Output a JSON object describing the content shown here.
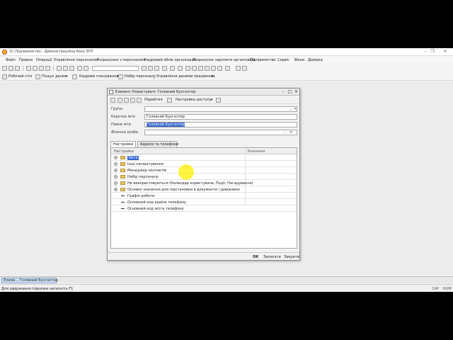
{
  "app": {
    "title": "1С:Підприємство - Демонстраційна база ЗУП"
  },
  "menu": [
    "Файл",
    "Правка",
    "Операції",
    "Управління персоналом",
    "Розрахунки з персоналом",
    "Кадровий облік організацій",
    "Розрахунок зарплати організацій",
    "Підприємство",
    "Сервіс",
    "Вікна",
    "Довідка"
  ],
  "toolbar2": {
    "desktop": "Робочий стіл",
    "search": "Пошук даних",
    "planning": "Кадрове планування",
    "hiring": "Набір персоналу",
    "employee_data": "Управління даними працівника"
  },
  "dialog": {
    "title": "Елемент Користувачі: Головний Бухгалтер",
    "goto": "Перейти",
    "access": "Настройка доступу",
    "fields": {
      "group_label": "Група:",
      "group_value": "",
      "short_name_label": "Коротке ім'я:",
      "short_name_value": "Головний Бухгалтер",
      "full_name_label": "Повне ім'я:",
      "full_name_value": "Головний Бухгалтер",
      "person_label": "Фізична особа:",
      "person_value": ""
    },
    "tabs": [
      "Настройки",
      "Адреси та телефони"
    ],
    "grid": {
      "col1": "Настройка",
      "col2": "Значення",
      "rows": [
        {
          "label": "Звіти",
          "kind": "folder",
          "selected": true
        },
        {
          "label": "Інші налаштування",
          "kind": "folder"
        },
        {
          "label": "Менеджер контактів",
          "kind": "folder"
        },
        {
          "label": "Набір персоналу",
          "kind": "folder"
        },
        {
          "label": "Не використовуються (Календар користувача, Події, Нагадування)",
          "kind": "folder"
        },
        {
          "label": "Основні значення для підстановки в документи і довідники",
          "kind": "folder"
        },
        {
          "label": "Графік роботи",
          "kind": "item"
        },
        {
          "label": "Основний код країни телефону",
          "kind": "item"
        },
        {
          "label": "Основний код міста телефону",
          "kind": "item"
        }
      ]
    },
    "footer": {
      "ok": "OK",
      "save": "Записати",
      "close": "Закрити"
    }
  },
  "taskbar": {
    "task_label": "Елеме... Головний Бухгалтер"
  },
  "status": {
    "hint": "Для одержання підказки натисніть F1",
    "cap": "CAP",
    "num": "NUM"
  }
}
